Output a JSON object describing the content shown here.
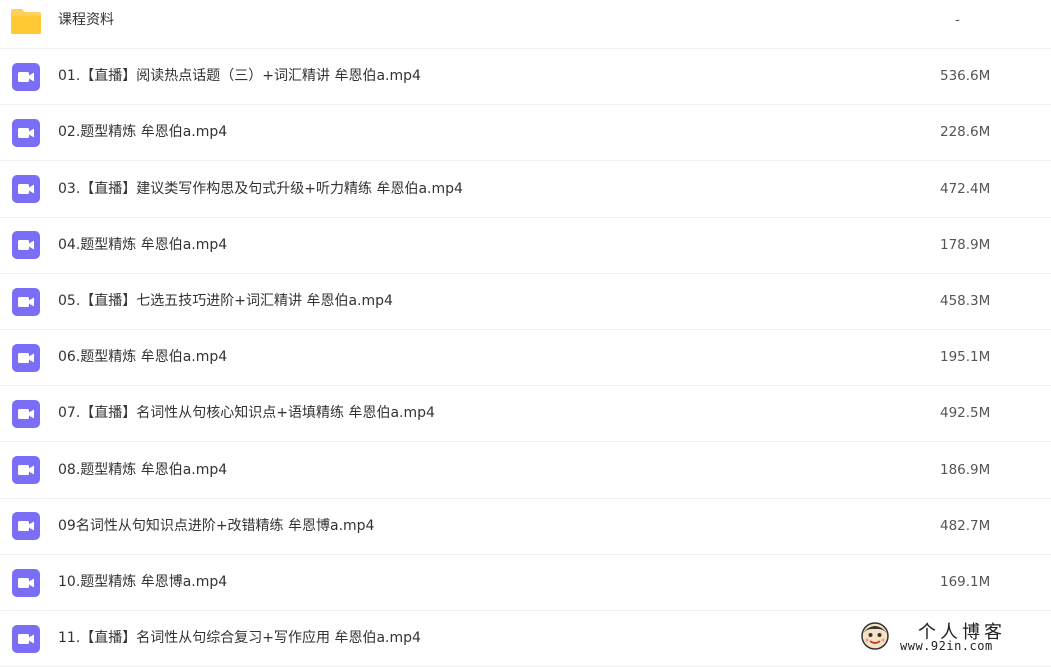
{
  "colors": {
    "folder_icon": "#ffd05b",
    "video_icon": "#7b6ef6",
    "row_divider": "#f1f2f4"
  },
  "files": [
    {
      "type": "folder",
      "icon": "folder-icon",
      "name": "课程资料",
      "size": "-"
    },
    {
      "type": "video",
      "icon": "video-icon",
      "name": "01.【直播】阅读热点话题（三）+词汇精讲 牟恩伯a.mp4",
      "size": "536.6M"
    },
    {
      "type": "video",
      "icon": "video-icon",
      "name": "02.题型精炼 牟恩伯a.mp4",
      "size": "228.6M"
    },
    {
      "type": "video",
      "icon": "video-icon",
      "name": "03.【直播】建议类写作构思及句式升级+听力精练 牟恩伯a.mp4",
      "size": "472.4M"
    },
    {
      "type": "video",
      "icon": "video-icon",
      "name": "04.题型精炼 牟恩伯a.mp4",
      "size": "178.9M"
    },
    {
      "type": "video",
      "icon": "video-icon",
      "name": "05.【直播】七选五技巧进阶+词汇精讲 牟恩伯a.mp4",
      "size": "458.3M"
    },
    {
      "type": "video",
      "icon": "video-icon",
      "name": "06.题型精炼 牟恩伯a.mp4",
      "size": "195.1M"
    },
    {
      "type": "video",
      "icon": "video-icon",
      "name": "07.【直播】名词性从句核心知识点+语填精练 牟恩伯a.mp4",
      "size": "492.5M"
    },
    {
      "type": "video",
      "icon": "video-icon",
      "name": "08.题型精炼 牟恩伯a.mp4",
      "size": "186.9M"
    },
    {
      "type": "video",
      "icon": "video-icon",
      "name": "09名词性从句知识点进阶+改错精练 牟恩博a.mp4",
      "size": "482.7M"
    },
    {
      "type": "video",
      "icon": "video-icon",
      "name": "10.题型精炼 牟恩博a.mp4",
      "size": "169.1M"
    },
    {
      "type": "video",
      "icon": "video-icon",
      "name": "11.【直播】名词性从句综合复习+写作应用 牟恩伯a.mp4",
      "size": ""
    }
  ],
  "watermark": {
    "title": "个人博客",
    "url": "www.92in.com"
  }
}
